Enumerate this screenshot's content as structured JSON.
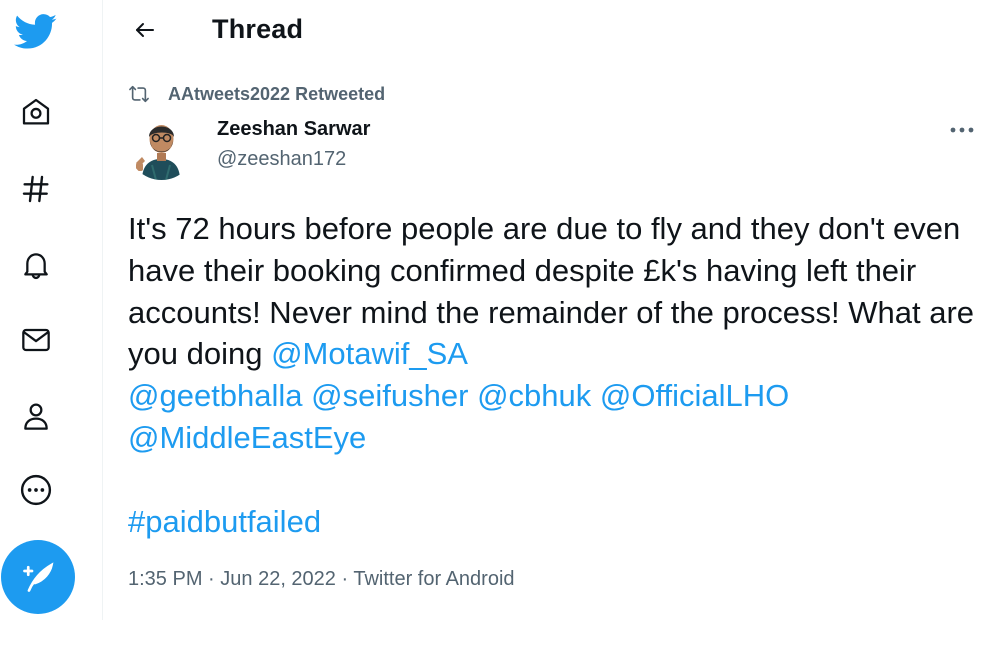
{
  "header": {
    "title": "Thread"
  },
  "retweet": {
    "label": "AAtweets2022 Retweeted"
  },
  "author": {
    "name": "Zeeshan Sarwar",
    "handle": "@zeeshan172"
  },
  "tweet": {
    "text1": "It's 72 hours before people are due to fly and they don't even have their booking confirmed despite £k's having left their accounts! Never mind the remainder of the process! What are you doing ",
    "mention1": "@Motawif_SA",
    "sp1": "\n",
    "mention2": "@geetbhalla",
    "sp2": " ",
    "mention3": "@seifusher",
    "sp3": " ",
    "mention4": "@cbhuk",
    "sp4": " ",
    "mention5": "@OfficialLHO",
    "sp5": "\n",
    "mention6": "@MiddleEastEye",
    "sp6": "\n\n",
    "hashtag": "#paidbutfailed"
  },
  "meta": {
    "time": "1:35 PM",
    "sep1": " · ",
    "date": "Jun 22, 2022",
    "sep2": " · ",
    "source": "Twitter for Android"
  },
  "colors": {
    "accent": "#1d9bf0",
    "secondary_text": "#536471",
    "primary_text": "#0f1419"
  },
  "icons": [
    "twitter-logo-icon",
    "home-icon",
    "explore-hashtag-icon",
    "notifications-bell-icon",
    "messages-envelope-icon",
    "profile-icon",
    "more-circle-icon",
    "compose-feather-icon",
    "back-arrow-icon",
    "retweet-icon",
    "more-dots-icon"
  ]
}
